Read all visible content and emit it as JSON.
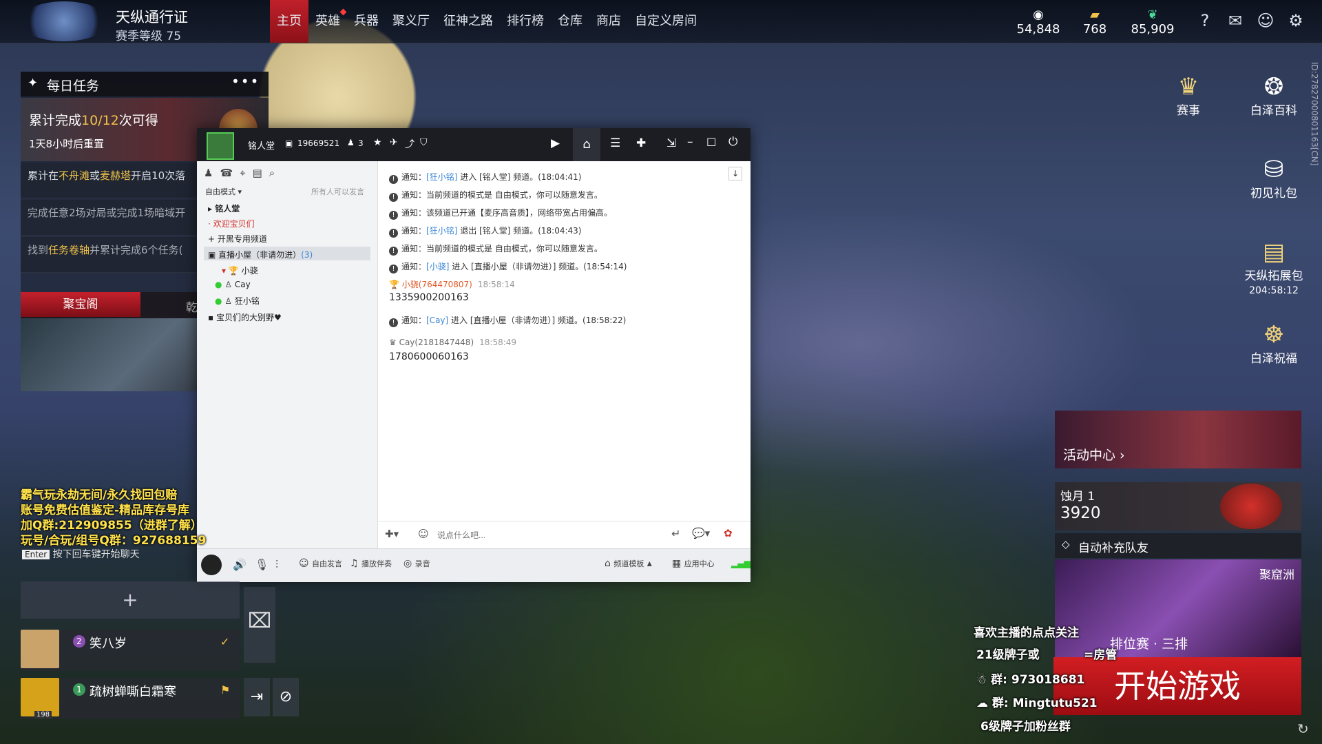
{
  "pass": {
    "title": "天纵通行证",
    "season_level": "赛季等级 75"
  },
  "nav": [
    "主页",
    "英雄",
    "兵器",
    "聚义厅",
    "征神之路",
    "排行榜",
    "仓库",
    "商店",
    "自定义房间"
  ],
  "currencies": [
    {
      "icon": "gold-coin-icon",
      "value": "54,848"
    },
    {
      "icon": "ticket-icon",
      "value": "768"
    },
    {
      "icon": "jade-feather-icon",
      "value": "85,909"
    }
  ],
  "top_icons": [
    "help-icon",
    "mail-icon",
    "friends-icon",
    "settings-icon"
  ],
  "daily": {
    "title": "每日任务",
    "progress_prefix": "累计完成",
    "progress_value": "10/12",
    "progress_suffix": "次可得",
    "reset": "1天8小时后重置",
    "tasks": [
      {
        "a": "累计在",
        "b": "不舟滩",
        "c": "或",
        "d": "麦赫塔",
        "e": "开启10次落"
      },
      {
        "a": "完成任意2场对局或完成1场暗域开",
        "b": "",
        "c": "",
        "d": "",
        "e": ""
      },
      {
        "a": "找到",
        "b": "任务卷轴",
        "c": "并累计完成6个任务(",
        "d": "",
        "e": ""
      }
    ],
    "tab1": "聚宝阁",
    "tab2": "乾"
  },
  "chat": {
    "room_name": "铭人堂",
    "room_id": "19669521",
    "online": "3",
    "mode": "自由模式",
    "mode_note": "所有人可以发言",
    "channels": [
      {
        "name": "铭人堂",
        "style": "bold"
      },
      {
        "name": "欢迎宝贝们",
        "style": "red"
      },
      {
        "name": "开黑专用频道",
        "style": "normal"
      },
      {
        "name": "直播小屋（非请勿进）",
        "count": "(3)",
        "style": "selected"
      },
      {
        "name": "小骁",
        "style": "member"
      },
      {
        "name": "Cay",
        "style": "member"
      },
      {
        "name": "狂小铭",
        "style": "member"
      },
      {
        "name": "宝贝们的大别野♥",
        "style": "normal"
      }
    ],
    "messages": [
      {
        "type": "notice",
        "pre": "通知：",
        "hl": "[狂小铭]",
        "post": "进入 [铭人堂] 频道。(18:04:41)"
      },
      {
        "type": "notice",
        "pre": "通知：",
        "hl": "",
        "post": "当前频道的模式是 自由模式，你可以随意发言。"
      },
      {
        "type": "notice",
        "pre": "通知：",
        "hl": "",
        "post": "该频道已开通【麦序高音质】，网络带宽占用偏高。"
      },
      {
        "type": "notice",
        "pre": "通知：",
        "hl": "[狂小铭]",
        "post": "退出 [铭人堂] 频道。(18:04:43)"
      },
      {
        "type": "notice",
        "pre": "通知：",
        "hl": "",
        "post": "当前频道的模式是 自由模式，你可以随意发言。"
      },
      {
        "type": "notice",
        "pre": "通知：",
        "hl": "[小骁]",
        "post": "进入 [直播小屋（非请勿进）] 频道。(18:54:14)"
      },
      {
        "type": "user",
        "nick": "小骁(764470807)",
        "time": "18:58:14",
        "text": "1335900200163"
      },
      {
        "type": "notice",
        "pre": "通知：",
        "hl": "[Cay]",
        "post": "进入 [直播小屋（非请勿进）] 频道。(18:58:22)"
      },
      {
        "type": "user",
        "nick": "Cay(2181847448)",
        "time": "18:58:49",
        "text": "1780600060163"
      }
    ],
    "input_placeholder": "说点什么吧...",
    "bottom": {
      "free_speak": "自由发言",
      "music": "播放伴奏",
      "record": "录音",
      "template": "频道模板",
      "app_center": "应用中心"
    }
  },
  "overlay_left": [
    "霸气玩永劫无间/永久找回包赔",
    "账号免费估值鉴定-精品库存号库",
    "加Q群:212909855（进群了解）",
    "玩号/合玩/组号Q群：927688159"
  ],
  "enter_hint": {
    "key": "Enter",
    "text": "按下回车键开始聊天"
  },
  "team": [
    {
      "num": "2",
      "name": "笑八岁"
    },
    {
      "num": "1",
      "name": "疏树蝉嘶白霜寒",
      "level": "198"
    }
  ],
  "right": {
    "items": [
      {
        "label": "赛事",
        "icon": "trophy-icon"
      },
      {
        "label": "白泽百科",
        "icon": "baize-icon"
      },
      {
        "label": "初见礼包",
        "icon": "gift-bag-icon"
      },
      {
        "label": "天纵拓展包",
        "sub": "204:58:12",
        "icon": "expansion-icon"
      },
      {
        "label": "白泽祝福",
        "icon": "blessing-icon"
      }
    ],
    "vertical_id": "ID:27827000801163[CN]",
    "activity_center": "活动中心 ›",
    "rank_name": "蚀月 1",
    "rank_score": "3920",
    "autofill": "自动补充队友",
    "map_name": "聚窟洲",
    "mode_text": "排位赛 · 三排",
    "start": "开始游戏"
  },
  "overlay_right": [
    "喜欢主播的点点关注",
    "21级牌子或",
    "=房管",
    "群: 973018681",
    "群: Mingtutu521",
    "6级牌子加粉丝群"
  ]
}
